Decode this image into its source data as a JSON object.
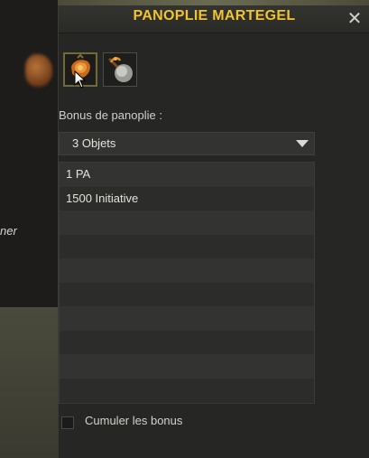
{
  "background": {
    "side_text": "ner"
  },
  "window": {
    "title": "PANOPLIE MARTEGEL",
    "close_icon": "close-icon",
    "items": [
      {
        "icon": "amulet-icon",
        "selected": true
      },
      {
        "icon": "hammer-icon",
        "selected": false
      }
    ],
    "bonus_label": "Bonus de panoplie :",
    "dropdown": {
      "selected": "3 Objets"
    },
    "bonus_rows": [
      "1 PA",
      "1500 Initiative",
      "",
      "",
      "",
      "",
      "",
      "",
      "",
      ""
    ],
    "cumulate": {
      "label": "Cumuler les bonus",
      "checked": false
    }
  },
  "colors": {
    "title": "#f0c431",
    "window_bg": "#262624"
  }
}
